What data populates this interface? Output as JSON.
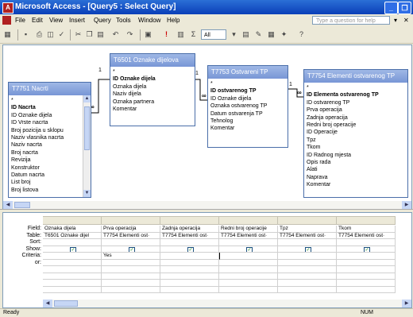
{
  "window": {
    "title": "Microsoft Access - [Query5 : Select Query]",
    "app_icon_letter": "A",
    "controls": {
      "minimize": "_",
      "restore": "❐"
    }
  },
  "menu": {
    "items": [
      "File",
      "Edit",
      "View",
      "Insert",
      "Query",
      "Tools",
      "Window",
      "Help"
    ],
    "help_placeholder": "Type a question for help",
    "help_dropdown": "▾",
    "doc_close": "✕"
  },
  "toolbar": {
    "select_value": "All",
    "icons": [
      "view-icon",
      "save-icon",
      "print-icon",
      "print-preview-icon",
      "spelling-icon",
      "cut-icon",
      "copy-icon",
      "paste-icon",
      "undo-icon",
      "redo-icon",
      "query-type-icon",
      "run-icon",
      "show-table-icon",
      "totals-icon",
      "top-values-icon",
      "properties-icon",
      "build-icon",
      "database-window-icon",
      "new-object-icon",
      "help-icon"
    ]
  },
  "tables": [
    {
      "title": "T7751 Nacrti",
      "fields": [
        {
          "name": "*",
          "bold": false
        },
        {
          "name": "ID Nacrta",
          "bold": true
        },
        {
          "name": "ID Oznake dijela",
          "bold": false
        },
        {
          "name": "ID Vrste nacrta",
          "bold": false
        },
        {
          "name": "Broj pozicija u sklopu",
          "bold": false
        },
        {
          "name": "Naziv vlasnika nacrta",
          "bold": false
        },
        {
          "name": "Naziv nacrta",
          "bold": false
        },
        {
          "name": "Broj nacrta",
          "bold": false
        },
        {
          "name": "Revizija",
          "bold": false
        },
        {
          "name": "Konstruktor",
          "bold": false
        },
        {
          "name": "Datum nacrta",
          "bold": false
        },
        {
          "name": "List broj",
          "bold": false
        },
        {
          "name": "Broj listova",
          "bold": false
        }
      ]
    },
    {
      "title": "T6501 Oznake dijelova",
      "fields": [
        {
          "name": "*",
          "bold": false
        },
        {
          "name": "ID Oznake dijela",
          "bold": true
        },
        {
          "name": "Oznaka dijela",
          "bold": false
        },
        {
          "name": "Naziv dijela",
          "bold": false
        },
        {
          "name": "Oznaka partnera",
          "bold": false
        },
        {
          "name": "Komentar",
          "bold": false
        }
      ]
    },
    {
      "title": "T7753 Ostvareni TP",
      "fields": [
        {
          "name": "*",
          "bold": false
        },
        {
          "name": "ID ostvarenog TP",
          "bold": true
        },
        {
          "name": "ID Oznake dijela",
          "bold": false
        },
        {
          "name": "Oznaka ostvarenog TP",
          "bold": false
        },
        {
          "name": "Datum ostvarenja TP",
          "bold": false
        },
        {
          "name": "Tehnolog",
          "bold": false
        },
        {
          "name": "Komentar",
          "bold": false
        }
      ]
    },
    {
      "title": "T7754 Elementi ostvarenog TP",
      "fields": [
        {
          "name": "*",
          "bold": false
        },
        {
          "name": "ID Elementa ostvarenog TP",
          "bold": true
        },
        {
          "name": "ID ostvarenog TP",
          "bold": false
        },
        {
          "name": "Prva operacija",
          "bold": false
        },
        {
          "name": "Zadnja operacija",
          "bold": false
        },
        {
          "name": "Redni broj operacije",
          "bold": false
        },
        {
          "name": "ID Operacije",
          "bold": false
        },
        {
          "name": "Tpz",
          "bold": false
        },
        {
          "name": "Tkom",
          "bold": false
        },
        {
          "name": "ID Radnog mjesta",
          "bold": false
        },
        {
          "name": "Opis rada",
          "bold": false
        },
        {
          "name": "Alati",
          "bold": false
        },
        {
          "name": "Naprava",
          "bold": false
        },
        {
          "name": "Komentar",
          "bold": false
        }
      ]
    }
  ],
  "joins": {
    "one": "1",
    "many": "∞"
  },
  "grid": {
    "row_labels": [
      "Field:",
      "Table:",
      "Sort:",
      "Show:",
      "Criteria:",
      "or:"
    ],
    "columns": [
      {
        "field": "Oznaka dijela",
        "table": "T6501 Oznake dijel",
        "sort": "",
        "show": true,
        "criteria": "",
        "or": ""
      },
      {
        "field": "Prva operacija",
        "table": "T7754 Elementi ost·",
        "sort": "",
        "show": true,
        "criteria": "Yes",
        "or": ""
      },
      {
        "field": "Zadnja operacija",
        "table": "T7754 Elementi ost·",
        "sort": "",
        "show": true,
        "criteria": "",
        "or": ""
      },
      {
        "field": "Redni broj operacije",
        "table": "T7754 Elementi ost·",
        "sort": "",
        "show": true,
        "criteria": "",
        "or": ""
      },
      {
        "field": "Tpz",
        "table": "T7754 Elementi ost·",
        "sort": "",
        "show": true,
        "criteria": "",
        "or": ""
      },
      {
        "field": "Tkom",
        "table": "T7754 Elementi ost·",
        "sort": "",
        "show": true,
        "criteria": "",
        "or": ""
      }
    ]
  },
  "status": {
    "left": "Ready",
    "right": "NUM"
  }
}
